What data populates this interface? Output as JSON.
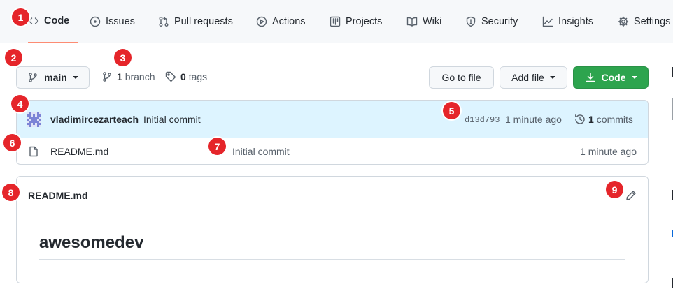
{
  "tabs": [
    {
      "label": "Code",
      "icon": "code-icon",
      "selected": true
    },
    {
      "label": "Issues",
      "icon": "issue-opened-icon"
    },
    {
      "label": "Pull requests",
      "icon": "git-pull-request-icon"
    },
    {
      "label": "Actions",
      "icon": "play-icon"
    },
    {
      "label": "Projects",
      "icon": "table-icon"
    },
    {
      "label": "Wiki",
      "icon": "book-icon"
    },
    {
      "label": "Security",
      "icon": "shield-icon"
    },
    {
      "label": "Insights",
      "icon": "graph-icon"
    },
    {
      "label": "Settings",
      "icon": "gear-icon"
    }
  ],
  "badges": [
    "1",
    "2",
    "3",
    "4",
    "5",
    "6",
    "7",
    "8",
    "9"
  ],
  "toolbar": {
    "branch_button": "main",
    "branch_count": "1",
    "branch_word": "branch",
    "tag_count": "0",
    "tag_word": "tags",
    "go_to_file": "Go to file",
    "add_file": "Add file",
    "code_button": "Code"
  },
  "commit": {
    "author": "vladimircezarteach",
    "message": "Initial commit",
    "sha": "d13d793",
    "time": "1 minute ago",
    "commit_count": "1",
    "commit_word": "commits"
  },
  "files": [
    {
      "name": "README.md",
      "message": "Initial commit",
      "time": "1 minute ago"
    }
  ],
  "readme": {
    "title": "README.md",
    "heading": "awesomedev"
  },
  "colors": {
    "accent_underline": "#fd8c73",
    "badge": "#e5252a",
    "primary_button": "#2da44e",
    "commit_bar": "#ddf4ff",
    "link": "#0969da"
  }
}
